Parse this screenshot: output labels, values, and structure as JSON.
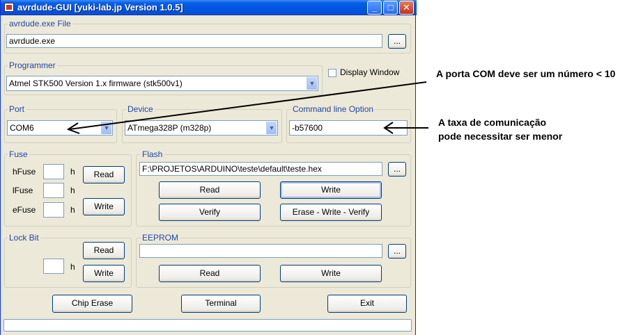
{
  "window": {
    "title": "avrdude-GUI [yuki-lab.jp Version 1.0.5]",
    "minimize_label": "_",
    "maximize_label": "□",
    "close_label": "✕"
  },
  "avrdude_file": {
    "label": "avrdude.exe File",
    "value": "avrdude.exe",
    "browse_label": "..."
  },
  "programmer": {
    "label": "Programmer",
    "value": "Atmel STK500 Version 1.x firmware (stk500v1)",
    "display_window_label": "Display Window",
    "display_window_checked": false
  },
  "port": {
    "label": "Port",
    "value": "COM6"
  },
  "device": {
    "label": "Device",
    "value": "ATmega328P (m328p)"
  },
  "command_line": {
    "label": "Command line Option",
    "value": "-b57600"
  },
  "fuse": {
    "label": "Fuse",
    "hfuse_label": "hFuse",
    "lfuse_label": "lFuse",
    "efuse_label": "eFuse",
    "unit": "h",
    "read_label": "Read",
    "write_label": "Write"
  },
  "flash": {
    "label": "Flash",
    "value": "F:\\PROJETOS\\ARDUINO\\teste\\default\\teste.hex",
    "browse_label": "...",
    "read_label": "Read",
    "write_label": "Write",
    "verify_label": "Verify",
    "erase_write_verify_label": "Erase - Write - Verify"
  },
  "lock_bit": {
    "label": "Lock Bit",
    "unit": "h",
    "read_label": "Read",
    "write_label": "Write"
  },
  "eeprom": {
    "label": "EEPROM",
    "value": "",
    "browse_label": "...",
    "read_label": "Read",
    "write_label": "Write"
  },
  "bottom": {
    "chip_erase_label": "Chip Erase",
    "terminal_label": "Terminal",
    "exit_label": "Exit"
  },
  "annotations": {
    "port_note": "A porta COM deve ser um número < 10",
    "baud_note_line1": "A taxa de comunicação",
    "baud_note_line2": "pode necessitar ser menor"
  },
  "colors": {
    "window_bg": "#ece9d8",
    "title_bar": "#0054e3",
    "group_label": "#1f47a8",
    "button_border": "#003c74"
  }
}
